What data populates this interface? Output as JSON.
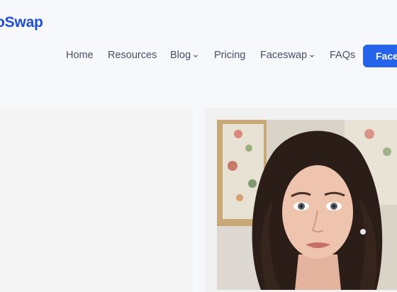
{
  "header": {
    "logo_text": "oSwap",
    "nav": [
      {
        "label": "Home",
        "dropdown": false
      },
      {
        "label": "Resources",
        "dropdown": false
      },
      {
        "label": "Blog",
        "dropdown": true
      },
      {
        "label": "Pricing",
        "dropdown": false
      },
      {
        "label": "Faceswap",
        "dropdown": true
      },
      {
        "label": "FAQs",
        "dropdown": false
      }
    ],
    "cta_label": "Face"
  },
  "colors": {
    "brand": "#1d4ed8",
    "cta": "#2563eb",
    "nav_text": "#475066",
    "background": "#f7f8fb"
  },
  "icons": {
    "blog_dropdown": "chevron-down-icon",
    "faceswap_dropdown": "chevron-down-icon"
  },
  "main": {
    "left_panel": "empty",
    "right_panel": "portrait-photo"
  }
}
